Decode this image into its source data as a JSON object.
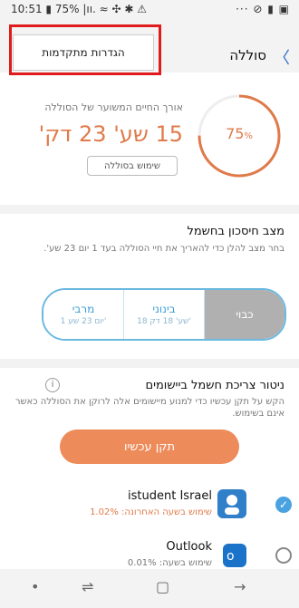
{
  "status": {
    "time": "10:51",
    "left_icons": "▮ 75% |ıı. ≈ ✣ ✱ ⚠",
    "right_icons": "··· ⊘ ▮ ▣"
  },
  "header": {
    "title": "סוללה",
    "advanced_label": "הגדרות מתקדמות"
  },
  "battery": {
    "percent": "75",
    "percent_unit": "%",
    "percent_value": 75,
    "est_label": "אורך החיים המשוער של הסוללה",
    "est_value": "15 שע' 23 דק'",
    "usage_button": "שימוש בסוללה"
  },
  "power_mode": {
    "title": "מצב חיסכון בחשמל",
    "desc": "בחר מצב להלן כדי להאריך את חיי הסוללה בעד 1 יום 23 שע'.",
    "modes": [
      {
        "label": "מרבי",
        "sub": "1 יום 23 שע'"
      },
      {
        "label": "בינוני",
        "sub": "18 שע' 18 דק'"
      },
      {
        "label": "כבוי",
        "sub": ""
      }
    ]
  },
  "app_monitor": {
    "title": "ניטור צריכת חשמל ביישומים",
    "desc": "הקש על תקן עכשיו כדי למנוע מיישומים אלה לרוקן את הסוללה כאשר אינם בשימוש.",
    "fix_button": "תקן עכשיו",
    "apps": [
      {
        "name": "istudent Israel",
        "sub": "שימוש בשעה האחרונה: 1.02%",
        "icon": "istudent-icon"
      },
      {
        "name": "Outlook",
        "sub": "שימוש בשעה: 0.01%",
        "icon": "outlook-icon"
      }
    ]
  },
  "nav": {
    "dot": "•",
    "recent": "⇌",
    "home": "▢",
    "back": "→"
  },
  "colors": {
    "accent": "#e07a4a",
    "blue": "#3a9fd4",
    "highlight": "#e11b1b"
  }
}
